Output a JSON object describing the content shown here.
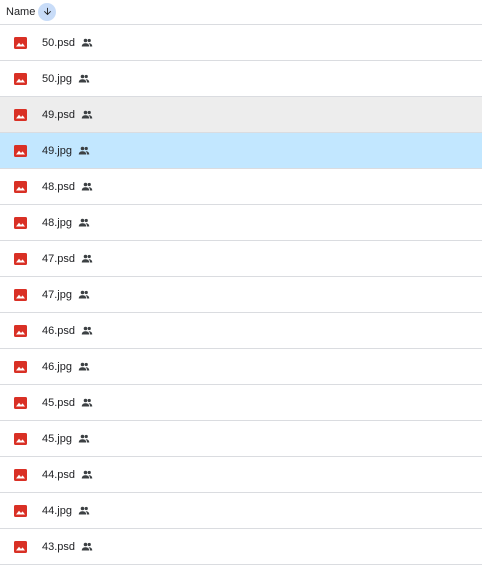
{
  "header": {
    "column_label": "Name",
    "sort_icon": "arrow-down-icon"
  },
  "colors": {
    "image_icon": "#d93025",
    "selected_row": "#c2e7ff",
    "hovered_row": "#ededed",
    "sort_button": "#c8dcf8"
  },
  "files": [
    {
      "name": "50.psd",
      "icon": "image-file-icon",
      "shared_icon": "people-icon",
      "state": "normal"
    },
    {
      "name": "50.jpg",
      "icon": "image-file-icon",
      "shared_icon": "people-icon",
      "state": "normal"
    },
    {
      "name": "49.psd",
      "icon": "image-file-icon",
      "shared_icon": "people-icon",
      "state": "hovered"
    },
    {
      "name": "49.jpg",
      "icon": "image-file-icon",
      "shared_icon": "people-icon",
      "state": "selected"
    },
    {
      "name": "48.psd",
      "icon": "image-file-icon",
      "shared_icon": "people-icon",
      "state": "normal"
    },
    {
      "name": "48.jpg",
      "icon": "image-file-icon",
      "shared_icon": "people-icon",
      "state": "normal"
    },
    {
      "name": "47.psd",
      "icon": "image-file-icon",
      "shared_icon": "people-icon",
      "state": "normal"
    },
    {
      "name": "47.jpg",
      "icon": "image-file-icon",
      "shared_icon": "people-icon",
      "state": "normal"
    },
    {
      "name": "46.psd",
      "icon": "image-file-icon",
      "shared_icon": "people-icon",
      "state": "normal"
    },
    {
      "name": "46.jpg",
      "icon": "image-file-icon",
      "shared_icon": "people-icon",
      "state": "normal"
    },
    {
      "name": "45.psd",
      "icon": "image-file-icon",
      "shared_icon": "people-icon",
      "state": "normal"
    },
    {
      "name": "45.jpg",
      "icon": "image-file-icon",
      "shared_icon": "people-icon",
      "state": "normal"
    },
    {
      "name": "44.psd",
      "icon": "image-file-icon",
      "shared_icon": "people-icon",
      "state": "normal"
    },
    {
      "name": "44.jpg",
      "icon": "image-file-icon",
      "shared_icon": "people-icon",
      "state": "normal"
    },
    {
      "name": "43.psd",
      "icon": "image-file-icon",
      "shared_icon": "people-icon",
      "state": "normal"
    }
  ]
}
